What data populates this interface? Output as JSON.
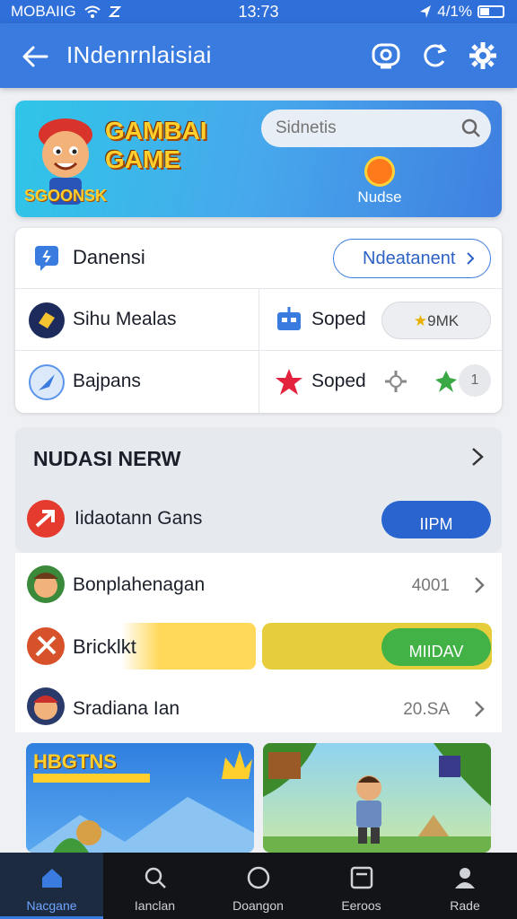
{
  "status_bar": {
    "carrier": "MOBAIIG",
    "time": "13:73",
    "battery": "4/1%"
  },
  "app_bar": {
    "title": "INdenrnlaisiai"
  },
  "banner": {
    "game_title_line1": "GAMBAI",
    "game_title_line2": "GAME",
    "game_subtitle": "SGOONSK",
    "search_placeholder": "Sidnetis",
    "nudge_label": "Nudse"
  },
  "card": {
    "header_label": "Danensi",
    "header_button": "Ndeatanent",
    "cell1_label": "Sihu Mealas",
    "cell2_label": "Soped",
    "cell2_pill": "9MK",
    "cell3_label": "Bajpans",
    "cell4_label": "Soped",
    "cell4_count": "1"
  },
  "section": {
    "heading": "NUDASI NERW",
    "item_label": "Iidaotann Gans",
    "item_button": "IIPM"
  },
  "list": {
    "row1_label": "Bonplahenagan",
    "row1_value": "4001",
    "row2_label": "Bricklkt",
    "row2_button": "MIIDAV",
    "row3_label": "Sradiana Ian",
    "row3_value": "20.SA"
  },
  "thumbnails": {
    "thumb1_title": "HBGTNS"
  },
  "bottom_nav": [
    {
      "label": "Nacgane",
      "icon": "home-icon"
    },
    {
      "label": "Ianclan",
      "icon": "search-icon"
    },
    {
      "label": "Doangon",
      "icon": "circle-icon"
    },
    {
      "label": "Eeroos",
      "icon": "card-icon"
    },
    {
      "label": "Rade",
      "icon": "profile-icon"
    }
  ],
  "colors": {
    "primary": "#3a7be0",
    "accent_green": "#43b246",
    "accent_yellow": "#ffd85a"
  }
}
